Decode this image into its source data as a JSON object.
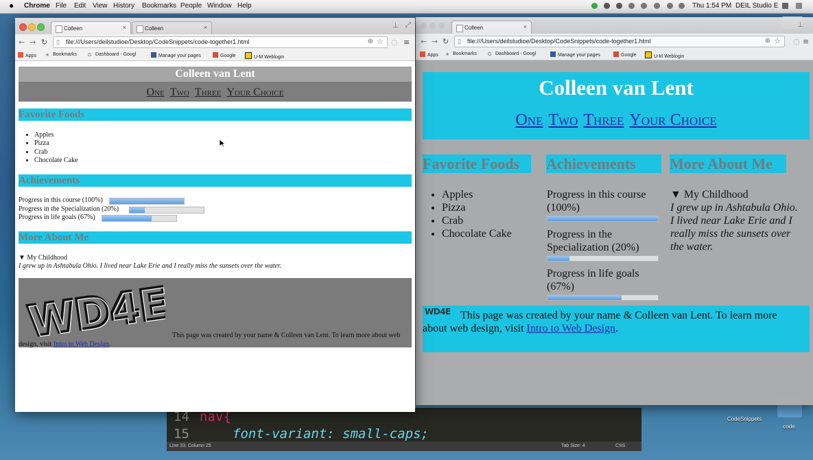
{
  "menubar": {
    "apple": "",
    "app": "Chrome",
    "items": [
      "File",
      "Edit",
      "View",
      "History",
      "Bookmarks",
      "People",
      "Window",
      "Help"
    ],
    "clock": "Thu 1:54 PM",
    "user": "DEIL Studio E"
  },
  "editor": {
    "lines": [
      {
        "num": "14",
        "text": "nav{"
      },
      {
        "num": "15",
        "text": "font-variant: small-caps;"
      }
    ],
    "status_left": "Line 33, Column 25",
    "status_tab": "Tab Size: 4",
    "status_lang": "CSS"
  },
  "desktop": {
    "icon1": "CodeSnippets",
    "icon2": "code"
  },
  "left_window": {
    "tabs": [
      {
        "title": "Colleen",
        "close": "×"
      },
      {
        "title": "Colleen",
        "close": "×"
      }
    ],
    "url": "file:///Users/deilstudioe/Desktop/CodeSnippets/code-together1.html",
    "bookmarks": [
      "Apps",
      "Bookmarks",
      "Dashboard - Googl",
      "Manage your pages",
      "Google",
      "U-M Weblogin"
    ],
    "page": {
      "title": "Colleen van Lent",
      "nav": [
        "One",
        "Two",
        "Three",
        "Your Choice"
      ],
      "foods_heading": "Favorite Foods",
      "foods": [
        "Apples",
        "Pizza",
        "Crab",
        "Chocolate Cake"
      ],
      "achievements_heading": "Achievements",
      "progress": [
        {
          "label": "Progress in this course (100%)",
          "value": 1.0
        },
        {
          "label": "Progress in the Specialization (20%)",
          "value": 0.2
        },
        {
          "label": "Progress in life goals (67%)",
          "value": 0.67
        }
      ],
      "about_heading": "More About Me",
      "summary": "▼ My Childhood",
      "detail": "I grew up in Ashtabula Ohio. I lived near Lake Erie and I really miss the sunsets over the water.",
      "logo": "WD4E",
      "footer_text": "This page was created by your name & Colleen van Lent. To learn more about web design, visit ",
      "footer_link": "Intro to Web Design",
      "footer_end": "."
    }
  },
  "right_window": {
    "tabs": [
      {
        "title": "Colleen",
        "close": "×"
      }
    ],
    "url": "file:///Users/deilstudioe/Desktop/CodeSnippets/code-together1.html",
    "bookmarks": [
      "Apps",
      "Bookmarks",
      "Dashboard - Googl",
      "Manage your pages",
      "Google",
      "U-M Weblogin"
    ],
    "page": {
      "title": "Colleen van Lent",
      "nav": [
        "One",
        "Two",
        "Three",
        "Your Choice"
      ],
      "foods_heading": "Favorite Foods",
      "foods": [
        "Apples",
        "Pizza",
        "Crab",
        "Chocolate Cake"
      ],
      "achievements_heading": "Achievements",
      "progress": [
        {
          "label": "Progress in this course (100%)",
          "value": 1.0
        },
        {
          "label": "Progress in the Specialization (20%)",
          "value": 0.2
        },
        {
          "label": "Progress in life goals (67%)",
          "value": 0.67
        }
      ],
      "about_heading": "More About Me",
      "summary": "▼ My Childhood",
      "detail": "I grew up in Ashtabula Ohio. I lived near Lake Erie and I really miss the sunsets over the water.",
      "logo": "WD4E",
      "footer_text": "This page was created by your name & Colleen van Lent. To learn more about web design, visit ",
      "footer_link": "Intro to Web Design",
      "footer_end": "."
    }
  },
  "colors": {
    "accent": "#1cc7e6",
    "header_gray": "#a5a5a5",
    "nav_gray": "#7e7e7e",
    "footer_gray": "#7b7b7b"
  }
}
